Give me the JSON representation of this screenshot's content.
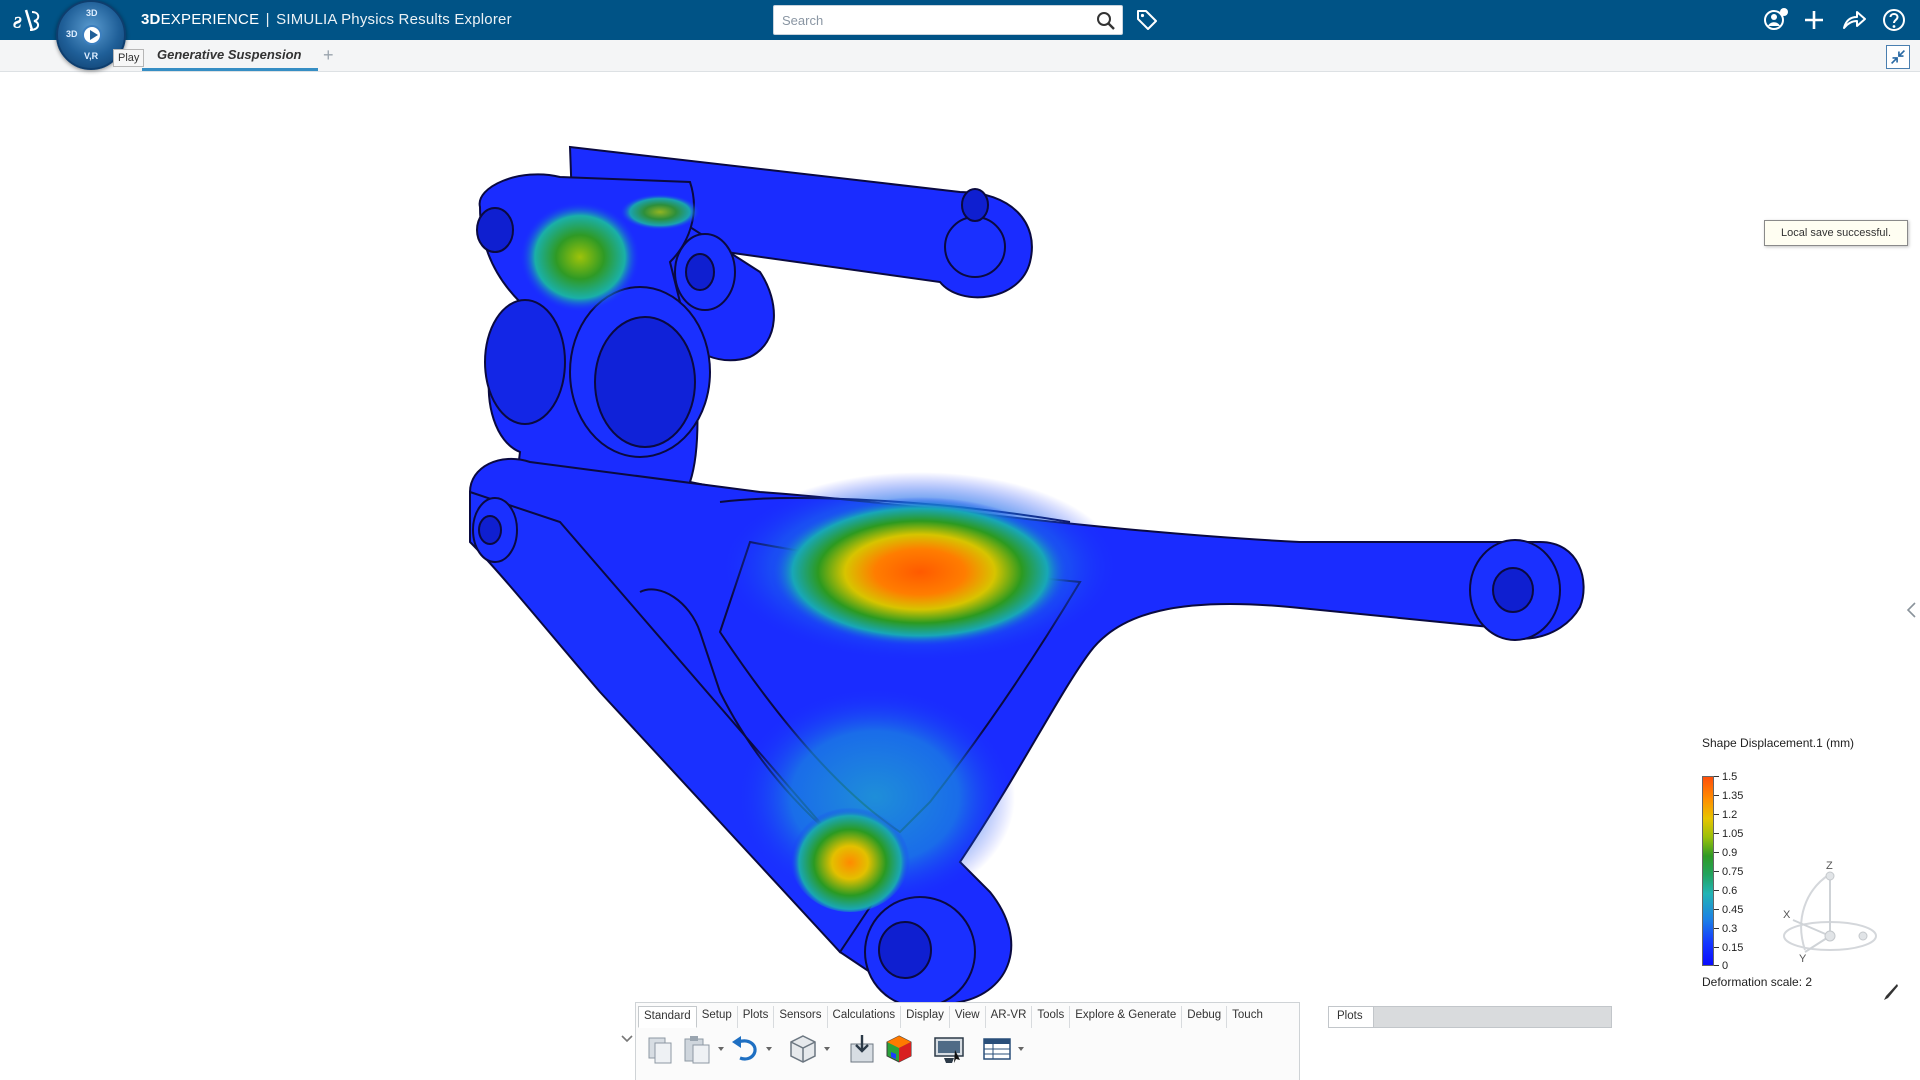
{
  "header": {
    "brand_bold": "3D",
    "brand_rest": "EXPERIENCE",
    "separator": "|",
    "app_name": "SIMULIA Physics Results Explorer",
    "compass": {
      "north": "3D",
      "west": "3D",
      "south": "V,R",
      "play_tooltip": "Play"
    }
  },
  "search": {
    "placeholder": "Search",
    "value": ""
  },
  "tabs": {
    "active": "Generative Suspension",
    "add": "+"
  },
  "toast": {
    "message": "Local save successful."
  },
  "legend": {
    "title": "Shape Displacement.1 (mm)",
    "values": [
      "1.5",
      "1.35",
      "1.2",
      "1.05",
      "0.9",
      "0.75",
      "0.6",
      "0.45",
      "0.3",
      "0.15",
      "0"
    ],
    "deformation": "Deformation scale: 2"
  },
  "triad": {
    "x": "X",
    "y": "Y",
    "z": "Z"
  },
  "action_bar": {
    "sections": [
      "Standard",
      "Setup",
      "Plots",
      "Sensors",
      "Calculations",
      "Display",
      "View",
      "AR-VR",
      "Tools",
      "Explore & Generate",
      "Debug",
      "Touch"
    ],
    "active_section": "Standard",
    "tools": [
      "copy-icon",
      "paste-icon",
      "undo-icon",
      "model-icon",
      "import-icon",
      "plot-icon",
      "image-capture-icon",
      "table-icon"
    ]
  },
  "plots_panel": {
    "tab": "Plots"
  },
  "colors": {
    "topbar": "#005386",
    "tab_underline": "#368ec4",
    "model_base": "#1a2cff"
  }
}
